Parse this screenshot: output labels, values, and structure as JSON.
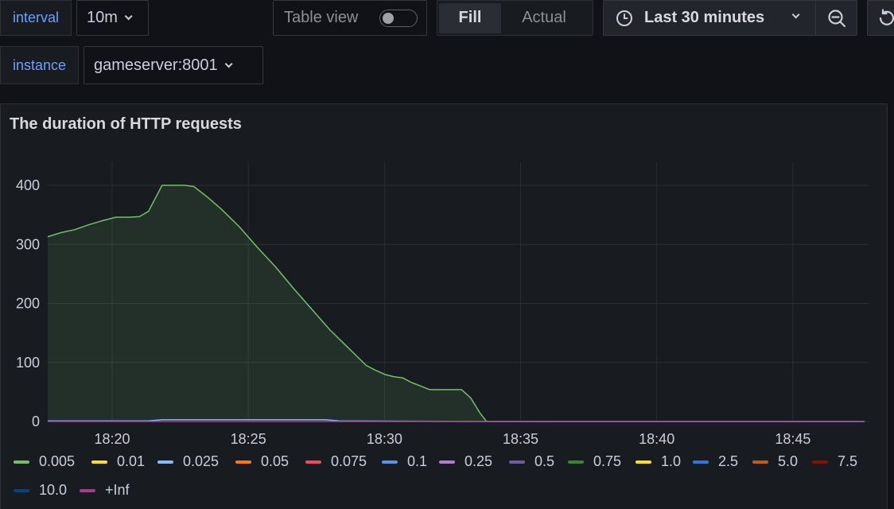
{
  "variables": {
    "interval": {
      "label": "interval",
      "value": "10m"
    },
    "instance": {
      "label": "instance",
      "value": "gameserver:8001"
    }
  },
  "toolbar": {
    "table_view_label": "Table view",
    "table_view_enabled": false,
    "fill_label": "Fill",
    "actual_label": "Actual",
    "time_range": "Last 30 minutes",
    "clock_icon": "clock-icon",
    "zoom_out_icon": "zoom-out-icon",
    "refresh_icon": "refresh-icon"
  },
  "panel": {
    "title": "The duration of HTTP requests"
  },
  "chart_data": {
    "type": "area",
    "title": "The duration of HTTP requests",
    "xlabel": "",
    "ylabel": "",
    "ylim": [
      0,
      440
    ],
    "yticks": [
      0,
      100,
      200,
      300,
      400
    ],
    "xticks": [
      "18:20",
      "18:25",
      "18:30",
      "18:35",
      "18:40",
      "18:45"
    ],
    "xrange": [
      "18:17:38",
      "18:47:38"
    ],
    "grid": true,
    "legend_position": "bottom",
    "series": [
      {
        "name": "0.005",
        "color": "#73bf69",
        "points": [
          [
            "18:17:38",
            313
          ],
          [
            "18:18:08",
            320
          ],
          [
            "18:18:38",
            325
          ],
          [
            "18:19:08",
            333
          ],
          [
            "18:19:38",
            340
          ],
          [
            "18:20:08",
            346
          ],
          [
            "18:20:38",
            346
          ],
          [
            "18:21:00",
            347
          ],
          [
            "18:21:20",
            356
          ],
          [
            "18:21:50",
            400
          ],
          [
            "18:22:20",
            400
          ],
          [
            "18:22:40",
            400
          ],
          [
            "18:23:00",
            398
          ],
          [
            "18:23:30",
            380
          ],
          [
            "18:24:00",
            360
          ],
          [
            "18:24:40",
            330
          ],
          [
            "18:25:20",
            295
          ],
          [
            "18:26:00",
            262
          ],
          [
            "18:26:40",
            225
          ],
          [
            "18:27:20",
            190
          ],
          [
            "18:28:00",
            155
          ],
          [
            "18:28:40",
            125
          ],
          [
            "18:29:20",
            95
          ],
          [
            "18:29:40",
            87
          ],
          [
            "18:30:00",
            80
          ],
          [
            "18:30:20",
            76
          ],
          [
            "18:30:40",
            74
          ],
          [
            "18:31:00",
            66
          ],
          [
            "18:31:20",
            60
          ],
          [
            "18:31:40",
            54
          ],
          [
            "18:32:00",
            54
          ],
          [
            "18:32:20",
            54
          ],
          [
            "18:32:50",
            54
          ],
          [
            "18:33:10",
            40
          ],
          [
            "18:33:30",
            15
          ],
          [
            "18:33:45",
            0
          ],
          [
            "18:47:38",
            0
          ]
        ]
      },
      {
        "name": "0.025",
        "color": "#8ab8ff",
        "points": [
          [
            "18:17:38",
            1
          ],
          [
            "18:21:20",
            1
          ],
          [
            "18:21:50",
            3
          ],
          [
            "18:27:50",
            3
          ],
          [
            "18:28:20",
            1
          ],
          [
            "18:33:45",
            0
          ],
          [
            "18:47:38",
            0
          ]
        ]
      },
      {
        "name": "+Inf",
        "color": "#a0408a",
        "points": [
          [
            "18:17:38",
            0
          ],
          [
            "18:47:38",
            0
          ]
        ]
      }
    ],
    "legend": [
      {
        "name": "0.005",
        "color": "#73bf69"
      },
      {
        "name": "0.01",
        "color": "#fade2a"
      },
      {
        "name": "0.025",
        "color": "#8ab8ff"
      },
      {
        "name": "0.05",
        "color": "#ff780a"
      },
      {
        "name": "0.075",
        "color": "#f2495c"
      },
      {
        "name": "0.1",
        "color": "#5794f2"
      },
      {
        "name": "0.25",
        "color": "#b877d9"
      },
      {
        "name": "0.5",
        "color": "#705da0"
      },
      {
        "name": "0.75",
        "color": "#37872d"
      },
      {
        "name": "1.0",
        "color": "#fade2a"
      },
      {
        "name": "2.5",
        "color": "#3274d9"
      },
      {
        "name": "5.0",
        "color": "#c15c17"
      },
      {
        "name": "7.5",
        "color": "#890f02"
      },
      {
        "name": "10.0",
        "color": "#0a437c"
      },
      {
        "name": "+Inf",
        "color": "#a0408a"
      }
    ]
  }
}
